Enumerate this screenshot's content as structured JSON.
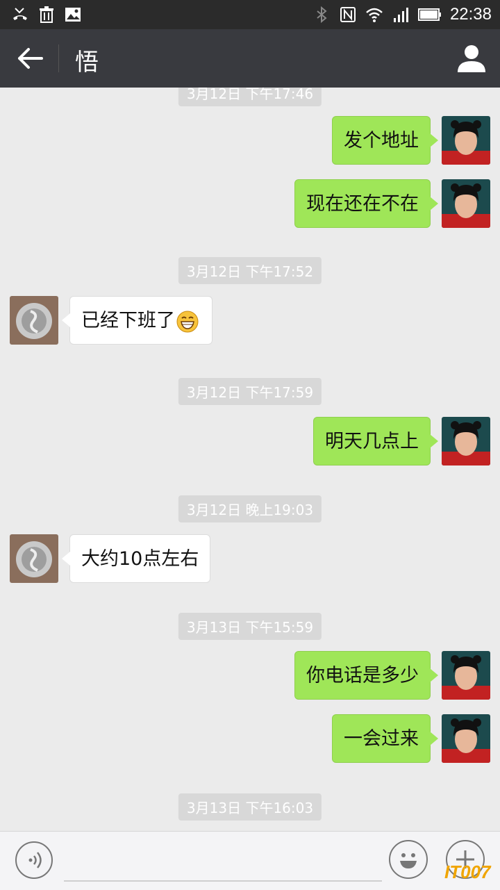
{
  "status_bar": {
    "time": "22:38",
    "icons": [
      "missed-call-icon",
      "trash-icon",
      "image-icon",
      "bluetooth-icon",
      "nfc-icon",
      "wifi-icon",
      "signal-icon",
      "battery-icon"
    ]
  },
  "header": {
    "title": "悟"
  },
  "messages": [
    {
      "kind": "timestamp",
      "text": "3月12日 下午17:46"
    },
    {
      "kind": "out",
      "text": "发个地址"
    },
    {
      "kind": "out",
      "text": "现在还在不在"
    },
    {
      "kind": "timestamp",
      "text": "3月12日 下午17:52"
    },
    {
      "kind": "in",
      "text": "已经下班了",
      "emoji": "grin-emoji"
    },
    {
      "kind": "timestamp",
      "text": "3月12日 下午17:59"
    },
    {
      "kind": "out",
      "text": "明天几点上"
    },
    {
      "kind": "timestamp",
      "text": "3月12日 晚上19:03"
    },
    {
      "kind": "in",
      "text": "大约10点左右"
    },
    {
      "kind": "timestamp",
      "text": "3月13日 下午15:59"
    },
    {
      "kind": "out",
      "text": "你电话是多少"
    },
    {
      "kind": "out",
      "text": "一会过来"
    },
    {
      "kind": "timestamp",
      "text": "3月13日 下午16:03"
    }
  ],
  "watermark": "IT007",
  "colors": {
    "status_bar_bg": "#2b2b2b",
    "title_bar_bg": "#393a3f",
    "chat_bg": "#ebebeb",
    "outgoing_bubble": "#9fe658",
    "incoming_bubble": "#ffffff",
    "timestamp_bg": "#d8d8d8"
  }
}
